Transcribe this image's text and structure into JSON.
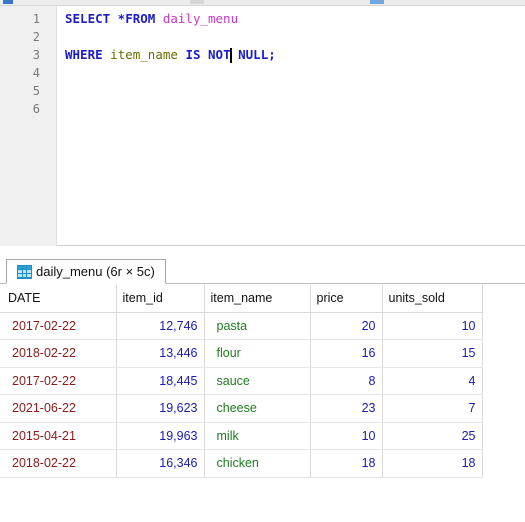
{
  "editor": {
    "line_numbers": [
      "1",
      "2",
      "3",
      "4",
      "5",
      "6"
    ],
    "line1": {
      "kw1": "SELECT *FROM",
      "table": "daily_menu"
    },
    "line3": {
      "kw1": "WHERE",
      "column": "item_name",
      "kw2a": "IS NOT",
      "kw2b": "NULL;"
    }
  },
  "result_tab": {
    "label": "daily_menu (6r × 5c)",
    "icon": "table-grid-icon"
  },
  "grid": {
    "columns": [
      "DATE",
      "item_id",
      "item_name",
      "price",
      "units_sold"
    ],
    "rows": [
      {
        "date": "2017-02-22",
        "item_id": "12,746",
        "item_name": "pasta",
        "price": "20",
        "units_sold": "10"
      },
      {
        "date": "2018-02-22",
        "item_id": "13,446",
        "item_name": "flour",
        "price": "16",
        "units_sold": "15"
      },
      {
        "date": "2017-02-22",
        "item_id": "18,445",
        "item_name": "sauce",
        "price": "8",
        "units_sold": "4"
      },
      {
        "date": "2021-06-22",
        "item_id": "19,623",
        "item_name": "cheese",
        "price": "23",
        "units_sold": "7"
      },
      {
        "date": "2015-04-21",
        "item_id": "19,963",
        "item_name": "milk",
        "price": "10",
        "units_sold": "25"
      },
      {
        "date": "2018-02-22",
        "item_id": "16,346",
        "item_name": "chicken",
        "price": "18",
        "units_sold": "18"
      }
    ]
  },
  "colors": {
    "keyword": "#1c1cc8",
    "table_name": "#c638c6",
    "column_name": "#6b6b00",
    "date_value": "#8b1a1a",
    "number_value": "#1a1ab0",
    "text_value": "#1f7d1f"
  }
}
